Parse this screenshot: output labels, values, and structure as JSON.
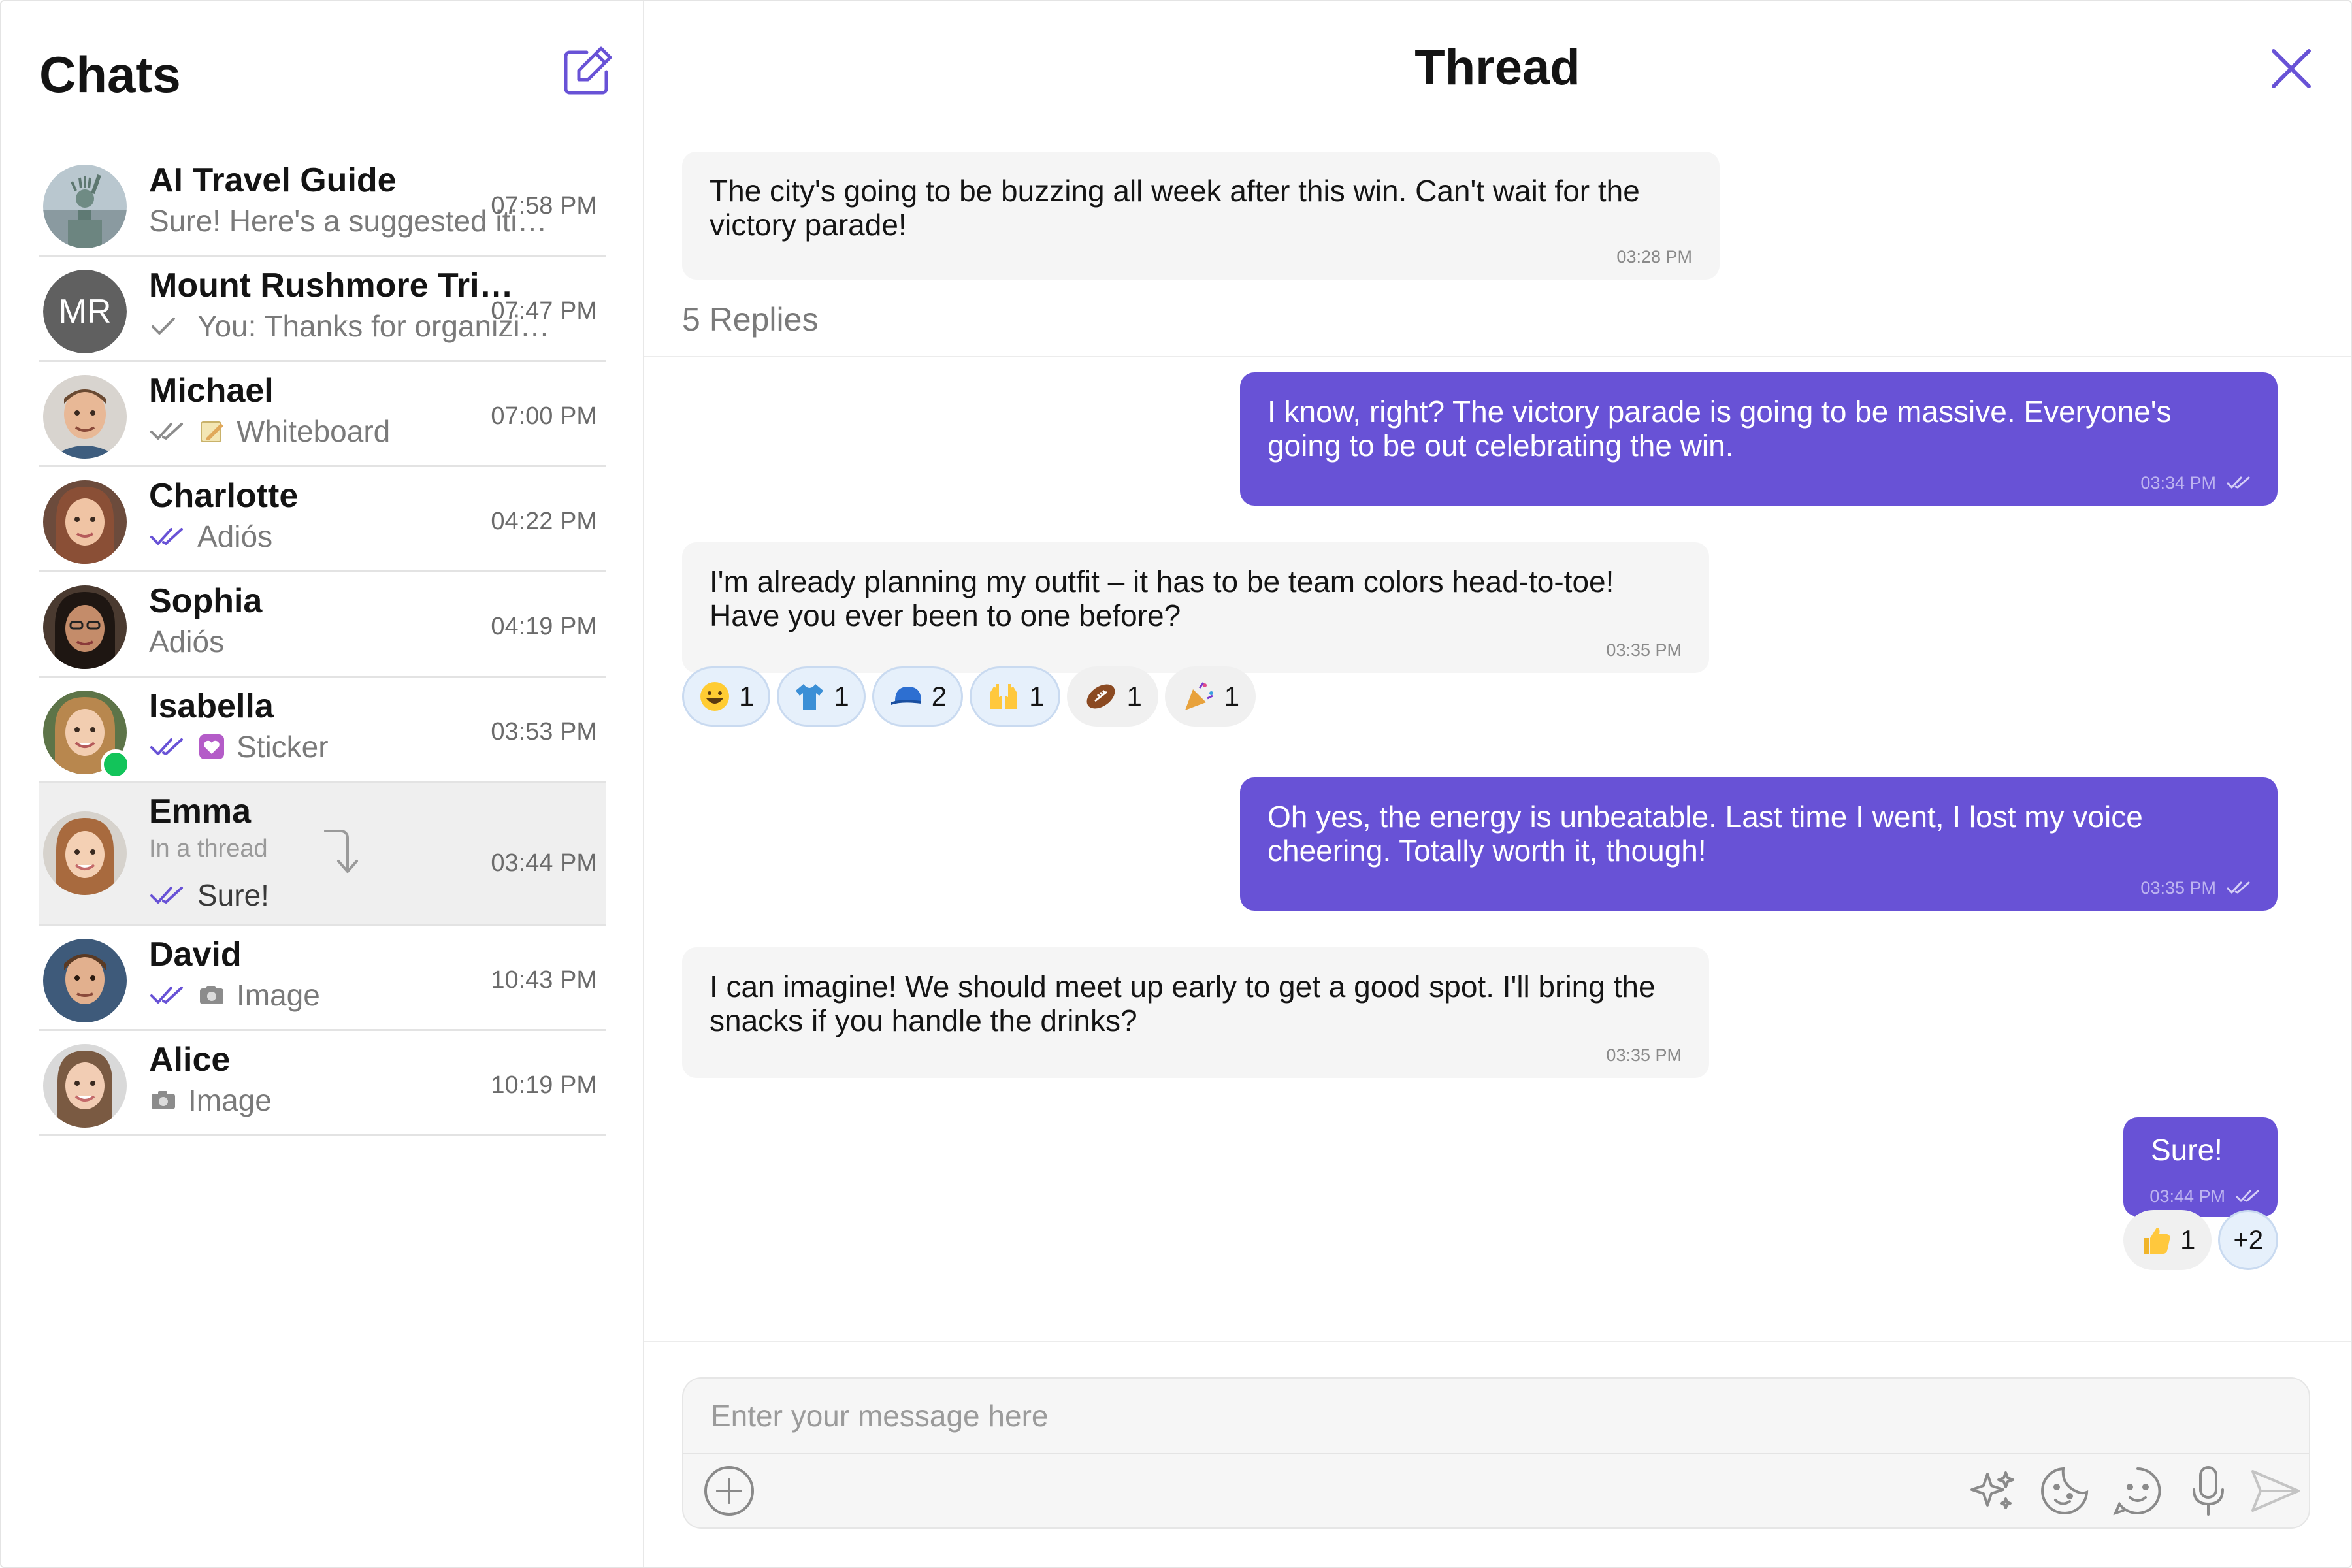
{
  "sidebar": {
    "title": "Chats",
    "compose_icon": "edit-square-icon",
    "chats": [
      {
        "name": "AI Travel Guide",
        "preview": "Sure! Here's a suggested itinerary for your trip...",
        "time": "07:58 PM",
        "avatar": "statue-of-liberty-photo"
      },
      {
        "name": "Mount Rushmore Trip Planning Group",
        "preview": "You: Thanks for organizing everything!",
        "time": "07:47 PM",
        "initials": "MR",
        "receipt": "sent-check-icon"
      },
      {
        "name": "Michael",
        "preview": "Whiteboard",
        "time": "07:00 PM",
        "avatar": "michael-photo",
        "receipt": "delivered-check-icon",
        "preview_icon": "whiteboard-icon"
      },
      {
        "name": "Charlotte",
        "preview": "Adiós",
        "time": "04:22 PM",
        "avatar": "charlotte-photo",
        "receipt": "read-check-icon"
      },
      {
        "name": "Sophia",
        "preview": "Adiós",
        "time": "04:19 PM",
        "avatar": "sophia-photo"
      },
      {
        "name": "Isabella",
        "preview": "Sticker",
        "time": "03:53 PM",
        "avatar": "isabella-photo",
        "receipt": "read-check-icon",
        "preview_icon": "sticker-icon",
        "online": true
      },
      {
        "name": "Emma",
        "thread_label": "In a thread",
        "preview": "Sure!",
        "time": "03:44 PM",
        "avatar": "emma-photo",
        "receipt": "read-check-icon",
        "active": true
      },
      {
        "name": "David",
        "preview": "Image",
        "time": "10:43 PM",
        "avatar": "david-photo",
        "receipt": "read-check-icon",
        "preview_icon": "camera-icon"
      },
      {
        "name": "Alice",
        "preview": "Image",
        "time": "10:19 PM",
        "avatar": "alice-photo",
        "preview_icon": "camera-icon"
      }
    ]
  },
  "thread": {
    "title": "Thread",
    "close_icon": "close-icon",
    "parent": {
      "text": "The city's going to be buzzing all week after this win. Can't wait for the victory parade!",
      "time": "03:28 PM"
    },
    "replies_label": "5 Replies",
    "messages": [
      {
        "direction": "out",
        "text": "I know, right? The victory parade is going to be massive. Everyone's going to be out celebrating the win.",
        "time": "03:34 PM"
      },
      {
        "direction": "in",
        "text": "I'm already planning my outfit – it has to be team colors head-to-toe! Have you ever been to one before?",
        "time": "03:35 PM",
        "reactions": [
          {
            "emoji": "grinning-face-emoji",
            "count": "1"
          },
          {
            "emoji": "t-shirt-emoji",
            "count": "1"
          },
          {
            "emoji": "billed-cap-emoji",
            "count": "2"
          },
          {
            "emoji": "raising-hands-emoji",
            "count": "1"
          },
          {
            "emoji": "american-football-emoji",
            "count": "1"
          },
          {
            "emoji": "party-popper-emoji",
            "count": "1"
          }
        ]
      },
      {
        "direction": "out",
        "text": "Oh yes, the energy is unbeatable. Last time I went, I lost my voice cheering. Totally worth it, though!",
        "time": "03:35 PM"
      },
      {
        "direction": "in",
        "text": "I can imagine! We should meet up early to get a good spot. I'll bring the snacks if you handle the drinks?",
        "time": "03:35 PM"
      },
      {
        "direction": "out",
        "text": "Sure!",
        "time": "03:44 PM",
        "reactions": [
          {
            "emoji": "thumbs-up-emoji",
            "count": "1"
          }
        ],
        "more_reactions": "+2"
      }
    ]
  },
  "composer": {
    "placeholder": "Enter your message here",
    "tools": [
      "add-attachment-icon",
      "ai-sparkle-icon",
      "sticker-icon",
      "emoji-icon",
      "microphone-icon",
      "send-icon"
    ]
  },
  "colors": {
    "accent": "#6852d6",
    "incoming_bubble": "#f5f5f5",
    "online": "#12c45a",
    "reaction_self": "#e6f0fb"
  }
}
